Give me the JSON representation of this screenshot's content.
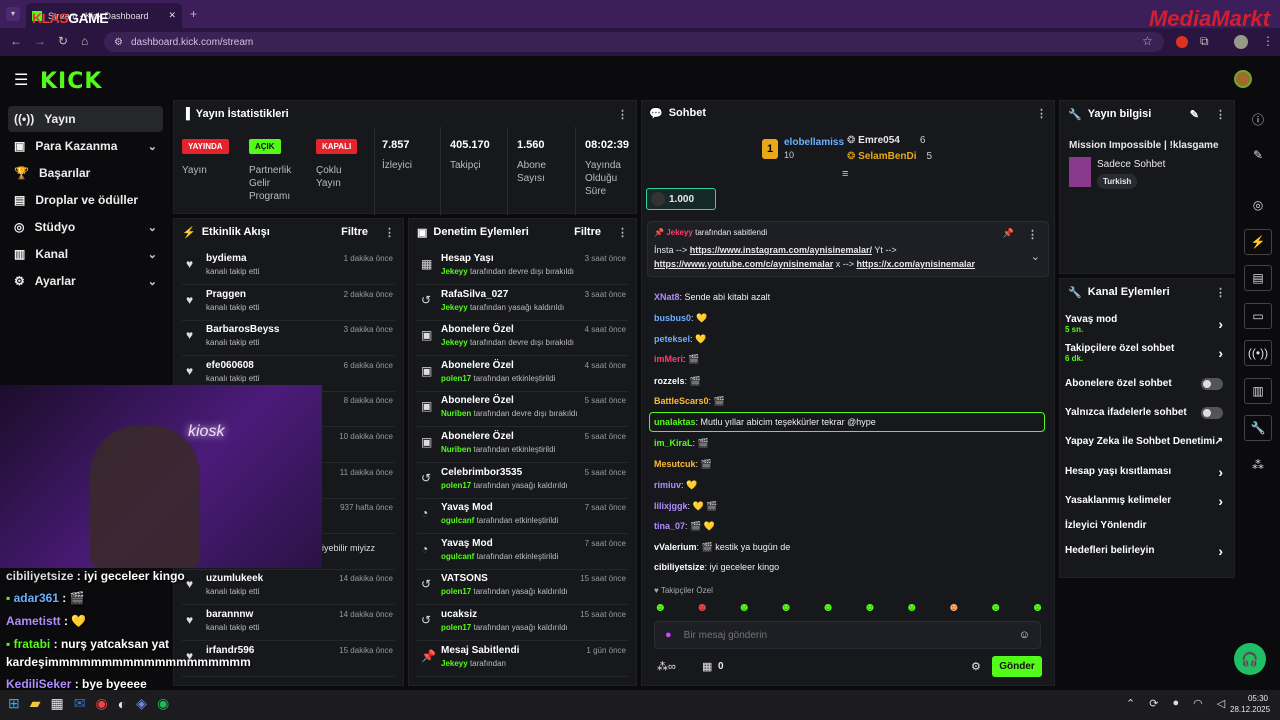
{
  "browser": {
    "tab_title": "Stream - Kick Dashboard",
    "url": "dashboard.kick.com/stream",
    "overlay_brand_left": "KLAS",
    "overlay_brand_right": "GAME",
    "overlay_brand_mm": "MediaMarkt"
  },
  "sidebar": {
    "items": [
      {
        "label": "Yayın"
      },
      {
        "label": "Para Kazanma"
      },
      {
        "label": "Başarılar"
      },
      {
        "label": "Droplar ve ödüller"
      },
      {
        "label": "Stüdyo"
      },
      {
        "label": "Kanal"
      },
      {
        "label": "Ayarlar"
      }
    ]
  },
  "stats": {
    "title": "Yayın İstatistikleri",
    "live_badge": "YAYINDA",
    "live_label": "Yayın",
    "partner_badge": "AÇIK",
    "partner_label": [
      "Partnerlik",
      "Gelir",
      "Programı"
    ],
    "multi_badge": "KAPALI",
    "multi_label": [
      "Çoklu",
      "Yayın"
    ],
    "viewers": "7.857",
    "viewers_label": "İzleyici",
    "followers": "405.170",
    "followers_label": "Takipçi",
    "subs": "1.560",
    "subs_label": [
      "Abone",
      "Sayısı"
    ],
    "uptime": "08:02:39",
    "uptime_label": [
      "Yayında",
      "Olduğu",
      "Süre"
    ]
  },
  "activity": {
    "title": "Etkinlik Akışı",
    "filter": "Filtre",
    "rows": [
      {
        "name": "bydiema",
        "sub": "kanalı takip etti",
        "time": "1 dakika önce"
      },
      {
        "name": "Praggen",
        "sub": "kanalı takip etti",
        "time": "2 dakika önce"
      },
      {
        "name": "BarbarosBeyss",
        "sub": "kanalı takip etti",
        "time": "3 dakika önce"
      },
      {
        "name": "efe060608",
        "sub": "kanalı takip etti",
        "time": "6 dakika önce"
      },
      {
        "name": "",
        "sub": "",
        "time": "8 dakika önce"
      },
      {
        "name": "",
        "sub": "",
        "time": "10 dakika önce"
      },
      {
        "name": "",
        "sub": "",
        "time": "11 dakika önce"
      },
      {
        "name": "",
        "sub": "",
        "time": "937 hafta önce"
      },
      {
        "name": "",
        "sub": "gönderdi",
        "time": ""
      },
      {
        "name": "uzumlukeek",
        "sub": "kanalı takip etti",
        "time": "14 dakika önce"
      },
      {
        "name": "barannnw",
        "sub": "kanalı takip etti",
        "time": "14 dakika önce"
      },
      {
        "name": "irfandr596",
        "sub": "",
        "time": "15 dakika önce"
      }
    ]
  },
  "moderation": {
    "title": "Denetim Eylemleri",
    "filter": "Filtre",
    "rows": [
      {
        "title": "Hesap Yaşı",
        "actor": "Jekeyy",
        "action": "tarafından devre dışı bırakıldı",
        "time": "3 saat önce"
      },
      {
        "title": "RafaSilva_027",
        "actor": "Jekeyy",
        "action": "tarafından yasağı kaldırıldı",
        "time": "3 saat önce"
      },
      {
        "title": "Abonelere Özel",
        "actor": "Jekeyy",
        "action": "tarafından devre dışı bırakıldı",
        "time": "4 saat önce"
      },
      {
        "title": "Abonelere Özel",
        "actor": "polen17",
        "action": "tarafından etkinleştirildi",
        "time": "4 saat önce"
      },
      {
        "title": "Abonelere Özel",
        "actor": "Nuriben",
        "action": "tarafından devre dışı bırakıldı",
        "time": "5 saat önce"
      },
      {
        "title": "Abonelere Özel",
        "actor": "Nuriben",
        "action": "tarafından etkinleştirildi",
        "time": "5 saat önce"
      },
      {
        "title": "Celebrimbor3535",
        "actor": "polen17",
        "action": "tarafından yasağı kaldırıldı",
        "time": "5 saat önce"
      },
      {
        "title": "Yavaş Mod",
        "actor": "ogulcanf",
        "action": "tarafından etkinleştirildi",
        "time": "7 saat önce"
      },
      {
        "title": "Yavaş Mod",
        "actor": "ogulcanf",
        "action": "tarafından etkinleştirildi",
        "time": "7 saat önce"
      },
      {
        "title": "VATSONS",
        "actor": "polen17",
        "action": "tarafından yasağı kaldırıldı",
        "time": "15 saat önce"
      },
      {
        "title": "ucaksiz",
        "actor": "polen17",
        "action": "tarafından yasağı kaldırıldı",
        "time": "15 saat önce"
      },
      {
        "title": "Mesaj Sabitlendi",
        "actor": "Jekeyy",
        "action": "tarafından",
        "time": "1 gün önce"
      }
    ]
  },
  "chat": {
    "title": "Sohbet",
    "top1_name": "elobellamiss",
    "top1_count": "10",
    "top2_name": "Emre054",
    "top2_count": "6",
    "top3_name": "SelamBenDi",
    "top3_count": "5",
    "goal": "1.000",
    "pinned_by": "Jekeyy",
    "pinned_suffix": "tarafından sabitlendi",
    "pinned_line1a": "İnsta --> ",
    "pinned_link1": "https://www.instagram.com/aynisinemalar/",
    "pinned_line1b": " Yt -->",
    "pinned_link2": "https://www.youtube.com/c/aynisinemalar",
    "pinned_mid": " x --> ",
    "pinned_link3": "https://x.com/aynisinemalar",
    "messages": [
      {
        "user": "XNat8",
        "text": "Sende abi kitabi azalt",
        "color": "#b18cff"
      },
      {
        "user": "busbus0",
        "text": "💛",
        "color": "#6ab0ff"
      },
      {
        "user": "peteksel",
        "text": "💛",
        "color": "#6ab0ff"
      },
      {
        "user": "imMeri",
        "text": "🎬",
        "color": "#ff3b6b"
      },
      {
        "user": "rozzels",
        "text": "🎬",
        "color": "#ffffff"
      },
      {
        "user": "BattleScars0",
        "text": "🎬",
        "color": "#ffbb33"
      },
      {
        "user": "unalaktas",
        "text": "Mutlu yıllar abicim teşekkürler tekrar @hype",
        "color": "#53fc18"
      },
      {
        "user": "im_KiraL",
        "text": "🎬",
        "color": "#53fc18"
      },
      {
        "user": "Mesutcuk",
        "text": "🎬",
        "color": "#ffbb33"
      },
      {
        "user": "rimiuv",
        "text": "💛",
        "color": "#b18cff"
      },
      {
        "user": "lilixjggk",
        "text": "💛 🎬",
        "color": "#b18cff"
      },
      {
        "user": "tina_07",
        "text": "🎬 💛",
        "color": "#b18cff"
      },
      {
        "user": "vValerium",
        "text": "🎬 kestik ya bugün de",
        "color": "#ffffff"
      },
      {
        "user": "cibiliyetsize",
        "text": "iyi geceleer kingo",
        "color": "#ffffff"
      }
    ],
    "followers_only": "Takipçiler Özel",
    "placeholder": "Bir mesaj gönderin",
    "points": "0",
    "send": "Gönder"
  },
  "stream_info": {
    "title": "Yayın bilgisi",
    "stream_title": "Mission Impossible | !klasgame",
    "category": "Sadece Sohbet",
    "tag": "Turkish"
  },
  "channel_actions": {
    "title": "Kanal Eylemleri",
    "slow": "Yavaş mod",
    "slow_val": "5 sn.",
    "followers": "Takipçilere özel sohbet",
    "followers_val": "6 dk.",
    "subs": "Abonelere özel sohbet",
    "emotes": "Yalnızca ifadelerle sohbet",
    "ai": "Yapay Zeka ile Sohbet Denetimi",
    "age": "Hesap yaşı kısıtlaması",
    "banned": "Yasaklanmış kelimeler",
    "raid": "İzleyici Yönlendir",
    "goals": "Hedefleri belirleyin"
  },
  "overlay_chat": [
    {
      "user": "cibiliyetsize",
      "text": " : iyi geceleer kingo"
    },
    {
      "user": "adar361",
      "text": " : 🎬"
    },
    {
      "user": "Aametistt",
      "text": " : 💛"
    },
    {
      "user": "fratabi",
      "text": " : nurş yatcaksan yat"
    },
    {
      "user": "",
      "text": "kardeşimmmmmmmmmmmmmmmmmmm"
    },
    {
      "user": "KediliSeker",
      "text": " : bye byeeee"
    }
  ],
  "overlay_partial": "iyebilir miyizz",
  "taskbar": {
    "time": "05:30",
    "date": "28.12.2025"
  }
}
